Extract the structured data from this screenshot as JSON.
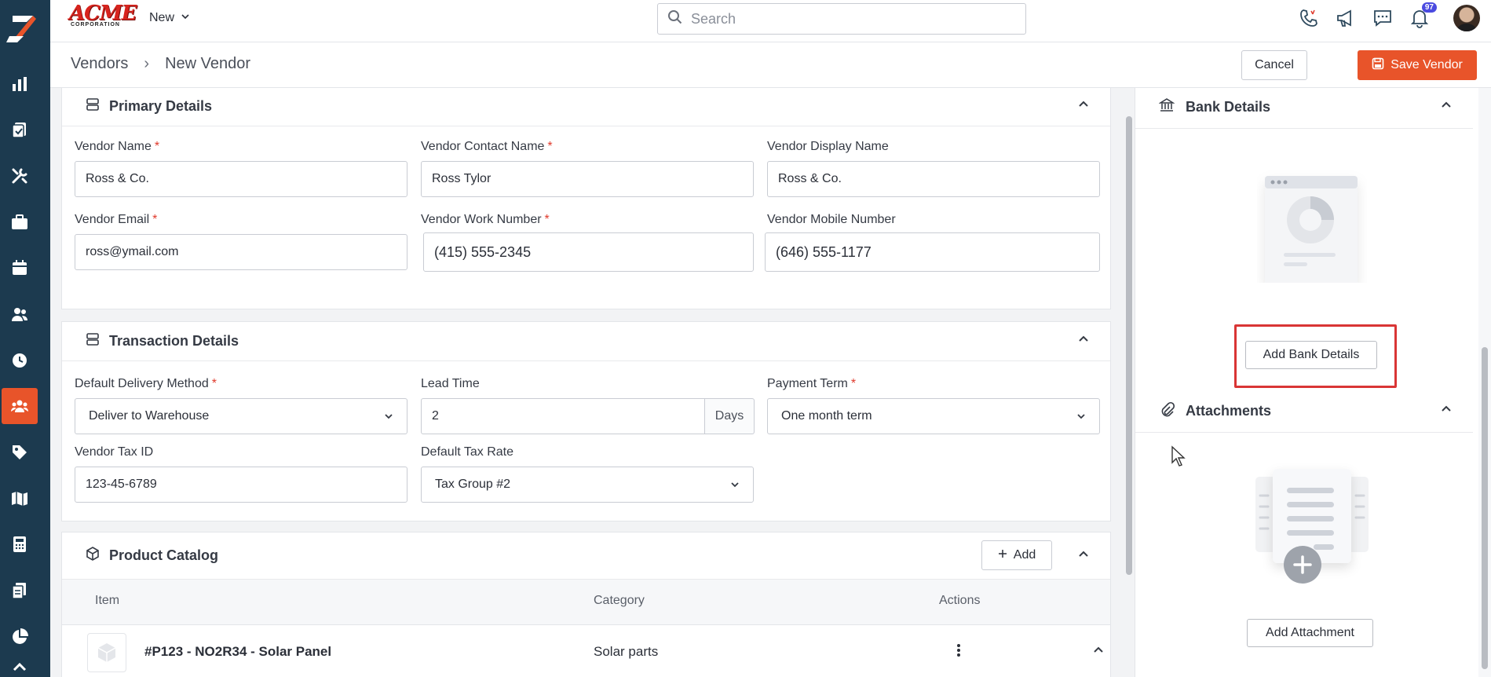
{
  "topbar": {
    "brand_name": "ACME",
    "brand_sub": "CORPORATION",
    "new_label": "New",
    "search_placeholder": "Search",
    "notification_count": "97"
  },
  "breadcrumb": {
    "root": "Vendors",
    "separator": "›",
    "current": "New Vendor"
  },
  "actions": {
    "cancel_label": "Cancel",
    "save_label": "Save Vendor"
  },
  "primary": {
    "title": "Primary Details",
    "fields": {
      "vendor_name_label": "Vendor Name",
      "vendor_name_value": "Ross & Co.",
      "contact_name_label": "Vendor Contact Name",
      "contact_name_value": "Ross Tylor",
      "display_name_label": "Vendor Display Name",
      "display_name_value": "Ross & Co.",
      "email_label": "Vendor Email",
      "email_value": "ross@ymail.com",
      "work_number_label": "Vendor Work Number",
      "work_number_value": "(415) 555-2345",
      "mobile_number_label": "Vendor Mobile Number",
      "mobile_number_value": "(646) 555-1177"
    }
  },
  "transaction": {
    "title": "Transaction Details",
    "fields": {
      "delivery_label": "Default Delivery Method",
      "delivery_value": "Deliver to Warehouse",
      "lead_time_label": "Lead Time",
      "lead_time_value": "2",
      "lead_time_unit": "Days",
      "payment_term_label": "Payment Term",
      "payment_term_value": "One month term",
      "tax_id_label": "Vendor Tax ID",
      "tax_id_value": "123-45-6789",
      "tax_rate_label": "Default Tax Rate",
      "tax_rate_value": "Tax Group #2"
    }
  },
  "catalog": {
    "title": "Product Catalog",
    "add_label": "Add",
    "columns": [
      "Item",
      "Category",
      "Actions"
    ],
    "rows": [
      {
        "item": "#P123 - NO2R34 - Solar Panel",
        "category": "Solar parts"
      }
    ]
  },
  "bank": {
    "title": "Bank Details",
    "button_label": "Add Bank Details"
  },
  "attachments": {
    "title": "Attachments",
    "button_label": "Add Attachment"
  },
  "colors": {
    "accent": "#e8542a",
    "sidebar": "#1c3a4f",
    "required": "#e03a2c",
    "highlight": "#d93535"
  }
}
